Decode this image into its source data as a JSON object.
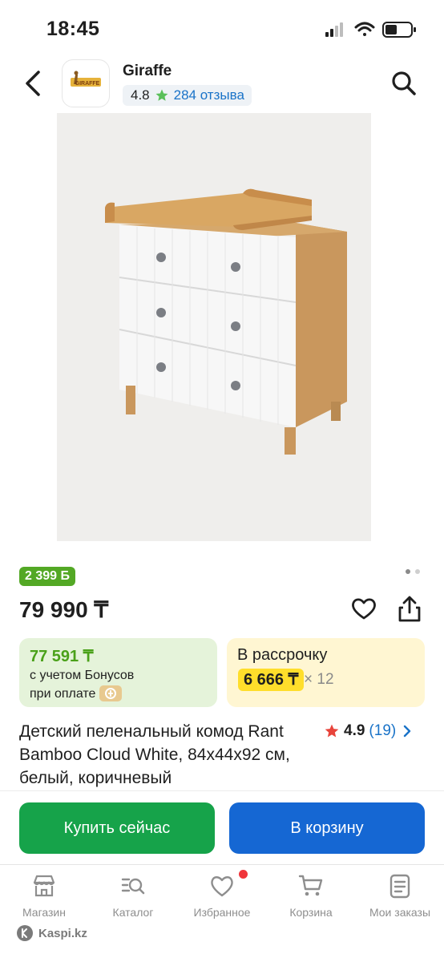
{
  "status_bar": {
    "time": "18:45"
  },
  "header": {
    "shop_name": "Giraffe",
    "logo_text": "GIRAFFE",
    "rating": "4.8",
    "reviews_link": "284 отзыва"
  },
  "product": {
    "bonus_badge": "2 399 Б",
    "price": "79 990 ₸",
    "image_pages": 2,
    "image_current": 1,
    "name": "Детский пеленальный комод Rant Bamboo Cloud White, 84x44x92 см, белый, коричневый",
    "rating": "4.9",
    "reviews_count": "(19)"
  },
  "bonus_card": {
    "price": "77 591 ₸",
    "line1": "с учетом Бонусов",
    "line2": "при оплате"
  },
  "installment_card": {
    "title": "В рассрочку",
    "monthly": "6 666 ₸",
    "months": "× 12"
  },
  "actions": {
    "buy_now": "Купить сейчас",
    "add_to_cart": "В корзину"
  },
  "tabbar": {
    "items": [
      {
        "label": "Магазин",
        "icon": "store-icon"
      },
      {
        "label": "Каталог",
        "icon": "catalog-search-icon"
      },
      {
        "label": "Избранное",
        "icon": "heart-icon",
        "badge": true
      },
      {
        "label": "Корзина",
        "icon": "cart-icon"
      },
      {
        "label": "Мои заказы",
        "icon": "orders-icon"
      }
    ]
  },
  "footer": {
    "brand": "Kaspi.kz"
  },
  "colors": {
    "green": "#16a34a",
    "blue": "#1567d3",
    "link": "#1a73c8",
    "bonus_green": "#53a825",
    "installment_yellow": "#ffde2b",
    "star_red": "#e8443b",
    "star_green": "#5ac05a"
  }
}
